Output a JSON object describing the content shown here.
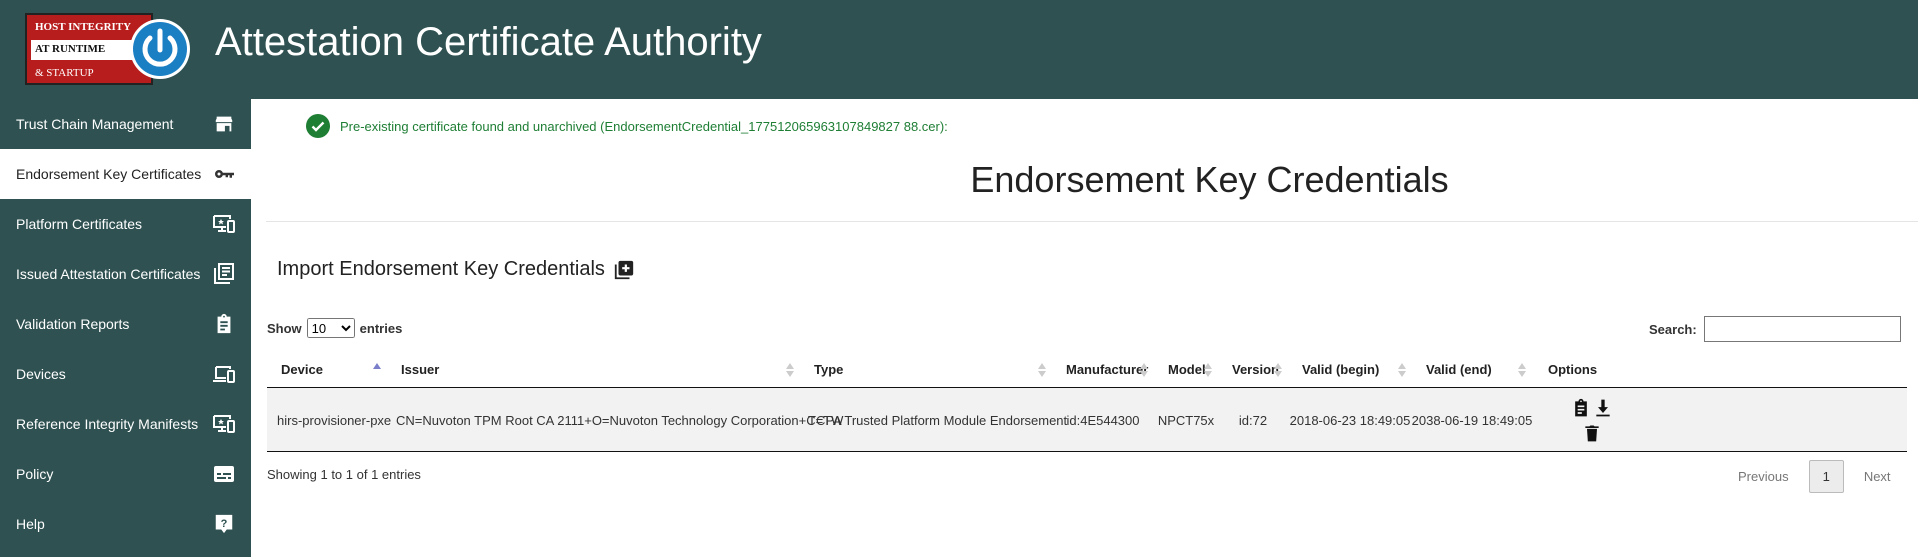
{
  "header": {
    "logo": {
      "line1": "HOST INTEGRITY",
      "line2": "AT RUNTIME",
      "line3": "& STARTUP"
    },
    "title": "Attestation Certificate Authority"
  },
  "sidebar": {
    "items": [
      {
        "label": "Trust Chain Management",
        "icon": "store-icon",
        "active": false
      },
      {
        "label": "Endorsement Key Certificates",
        "icon": "key-icon",
        "active": true
      },
      {
        "label": "Platform Certificates",
        "icon": "devices-icon",
        "active": false
      },
      {
        "label": "Issued Attestation Certificates",
        "icon": "library-books-icon",
        "active": false
      },
      {
        "label": "Validation Reports",
        "icon": "clipboard-icon",
        "active": false
      },
      {
        "label": "Devices",
        "icon": "laptop-phone-icon",
        "active": false
      },
      {
        "label": "Reference Integrity Manifests",
        "icon": "devices-icon",
        "active": false
      },
      {
        "label": "Policy",
        "icon": "subtitles-icon",
        "active": false
      },
      {
        "label": "Help",
        "icon": "help-icon",
        "active": false
      }
    ]
  },
  "alert": {
    "text": "Pre-existing certificate found and unarchived (EndorsementCredential_177512065963107849827 88.cer):"
  },
  "page_title": "Endorsement Key Credentials",
  "import": {
    "label": "Import Endorsement Key Credentials"
  },
  "table_controls": {
    "show_label": "Show",
    "entries_label": "entries",
    "page_length": "10",
    "search_label": "Search:",
    "search_value": ""
  },
  "table": {
    "columns": [
      "Device",
      "Issuer",
      "Type",
      "Manufacturer",
      "Model",
      "Version",
      "Valid (begin)",
      "Valid (end)",
      "Options"
    ],
    "rows": [
      {
        "device": "hirs-provisioner-pxe",
        "issuer": "CN=Nuvoton TPM Root CA 2111+O=Nuvoton Technology Corporation+C=TW",
        "type": "TCPA Trusted Platform Module Endorsement",
        "manufacturer": "id:4E544300",
        "model": "NPCT75x",
        "version": "id:72",
        "valid_begin": "2018-06-23 18:49:05",
        "valid_end": "2038-06-19 18:49:05"
      }
    ]
  },
  "footer": {
    "info": "Showing 1 to 1 of 1 entries",
    "previous": "Previous",
    "current_page": "1",
    "next": "Next"
  },
  "colors": {
    "header_bg": "#2f5151",
    "sidebar_bg": "#2f5151",
    "success": "#1e7e34",
    "logo_red": "#b81d1d",
    "logo_blue": "#1b7fc4"
  }
}
